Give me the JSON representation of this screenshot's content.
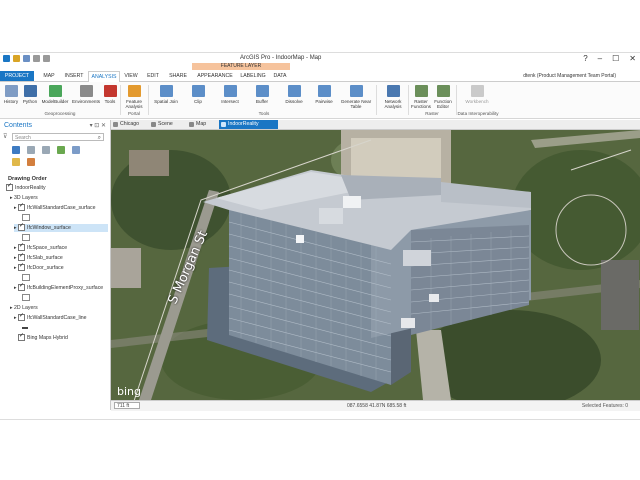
{
  "app": {
    "title": "ArcGIS Pro - IndoorMap - Map",
    "context_tab": "FEATURE LAYER",
    "window_controls": [
      "?",
      "–",
      "☐",
      "✕"
    ],
    "user": "dtenk (Product Management Team Portal)"
  },
  "tabs": [
    "PROJECT",
    "MAP",
    "INSERT",
    "ANALYSIS",
    "VIEW",
    "EDIT",
    "SHARE",
    "APPEARANCE",
    "LABELING",
    "DATA"
  ],
  "active_tab": "ANALYSIS",
  "ribbon": {
    "geoprocessing": {
      "label": "Geoprocessing",
      "buttons": [
        "History",
        "Python",
        "ModelBuilder",
        "Environments",
        "Tools"
      ]
    },
    "portal": {
      "label": "Portal",
      "buttons": [
        "Feature Analysis"
      ]
    },
    "tools": {
      "label": "Tools",
      "buttons": [
        "Spatial Join",
        "Clip",
        "Intersect",
        "Buffer",
        "Dissolve",
        "Pairwise",
        "Generate Near Table"
      ]
    },
    "network": {
      "buttons": [
        "Network Analysis"
      ]
    },
    "raster": {
      "label": "Raster",
      "buttons": [
        "Raster Functions",
        "Function Editor"
      ]
    },
    "interop": {
      "label": "Data Interoperability",
      "buttons": [
        "Workbench"
      ]
    }
  },
  "contents": {
    "title": "Contents",
    "search_placeholder": "Search",
    "drawing_order": "Drawing Order",
    "tree": [
      {
        "label": "IndoorReality",
        "level": 0,
        "checked": true,
        "type": "map"
      },
      {
        "label": "3D Layers",
        "level": 1,
        "type": "group"
      },
      {
        "label": "IfcWallStandardCase_surface",
        "level": 2,
        "checked": true,
        "type": "layer"
      },
      {
        "label": "",
        "level": 3,
        "type": "swatch"
      },
      {
        "label": "IfcWindow_surface",
        "level": 2,
        "checked": true,
        "type": "layer",
        "selected": true
      },
      {
        "label": "",
        "level": 3,
        "type": "swatch"
      },
      {
        "label": "IfcSpace_surface",
        "level": 2,
        "checked": true,
        "type": "layer"
      },
      {
        "label": "IfcSlab_surface",
        "level": 2,
        "checked": true,
        "type": "layer"
      },
      {
        "label": "IfcDoor_surface",
        "level": 2,
        "checked": true,
        "type": "layer"
      },
      {
        "label": "",
        "level": 3,
        "type": "swatch"
      },
      {
        "label": "IfcBuildingElementProxy_surface",
        "level": 2,
        "checked": true,
        "type": "layer"
      },
      {
        "label": "",
        "level": 3,
        "type": "swatch"
      },
      {
        "label": "2D Layers",
        "level": 1,
        "type": "group"
      },
      {
        "label": "IfcWallStandardCase_line",
        "level": 2,
        "checked": true,
        "type": "layer"
      },
      {
        "label": "",
        "level": 3,
        "type": "swatch"
      },
      {
        "label": "Bing Maps Hybrid",
        "level": 2,
        "checked": true,
        "type": "layer"
      }
    ]
  },
  "view_tabs": [
    "Chicago",
    "Scene",
    "Map",
    "IndoorReality"
  ],
  "active_view": "IndoorReality",
  "map": {
    "street_label": "S Morgan St",
    "basemap_logo": "bing"
  },
  "status": {
    "scale": "711 ft",
    "coords": "087.6558 41.87N    685.58 ft",
    "selected": "Selected Features: 0"
  },
  "colors": {
    "accent": "#1a76c4",
    "context_tab": "#f6c39c"
  }
}
